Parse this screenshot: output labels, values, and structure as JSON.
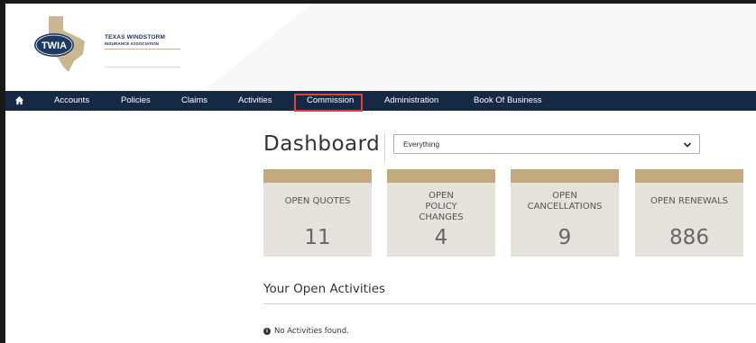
{
  "logo": {
    "badge": "TWIA",
    "name_line1": "TEXAS WINDSTORM",
    "name_line2": "INSURANCE ASSOCIATION"
  },
  "nav": {
    "home_icon": "home-icon",
    "items": [
      "Accounts",
      "Policies",
      "Claims",
      "Activities",
      "Commission",
      "Administration",
      "Book Of Business"
    ],
    "highlighted": "Commission"
  },
  "dashboard": {
    "title": "Dashboard",
    "filter": {
      "selected": "Everything"
    }
  },
  "cards": [
    {
      "label": "OPEN QUOTES",
      "value": "11"
    },
    {
      "label": "OPEN POLICY CHANGES",
      "value": "4"
    },
    {
      "label": "OPEN CANCELLATIONS",
      "value": "9"
    },
    {
      "label": "OPEN RENEWALS",
      "value": "886"
    }
  ],
  "activities": {
    "title": "Your Open Activities",
    "empty_message": "No Activities found."
  },
  "colors": {
    "nav_bg": "#152944",
    "card_bg": "#e5e2db",
    "card_accent": "#c3a97d",
    "highlight": "#e04040"
  }
}
